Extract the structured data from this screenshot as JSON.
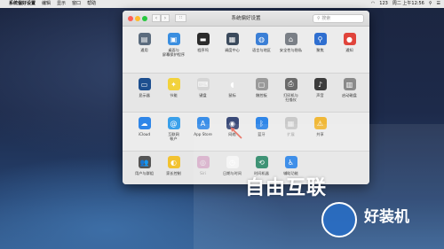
{
  "menubar": {
    "apple": "",
    "app_name": "系统偏好设置",
    "items": [
      "编辑",
      "显示",
      "窗口",
      "帮助"
    ],
    "time": "周二 上午12:56",
    "input": "123"
  },
  "window": {
    "title": "系统偏好设置",
    "search_placeholder": "搜索",
    "grid_label": "∷"
  },
  "panes": {
    "row1": [
      {
        "label": "通用",
        "icon": "general-icon",
        "color": "#5b6b7d",
        "glyph": "▤"
      },
      {
        "label": "桌面与\n屏幕保护程序",
        "icon": "desktop-icon",
        "color": "#3a8ee0",
        "glyph": "▣"
      },
      {
        "label": "程序坞",
        "icon": "dock-icon",
        "color": "#2b2b2b",
        "glyph": "▬"
      },
      {
        "label": "调度中心",
        "icon": "mission-control-icon",
        "color": "#3b4a5c",
        "glyph": "▦"
      },
      {
        "label": "语言与地区",
        "icon": "language-icon",
        "color": "#3b7fd6",
        "glyph": "◍"
      },
      {
        "label": "安全性与隐私",
        "icon": "security-icon",
        "color": "#7a7f86",
        "glyph": "⌂"
      },
      {
        "label": "聚焦",
        "icon": "spotlight-icon",
        "color": "#2f6fd0",
        "glyph": "⚲"
      },
      {
        "label": "通知",
        "icon": "notifications-icon",
        "color": "#e0443b",
        "glyph": "●"
      }
    ],
    "row2": [
      {
        "label": "显示器",
        "icon": "displays-icon",
        "color": "#1d4f8f",
        "glyph": "▭"
      },
      {
        "label": "节能",
        "icon": "energy-icon",
        "color": "#f2d23c",
        "glyph": "✦"
      },
      {
        "label": "键盘",
        "icon": "keyboard-icon",
        "color": "#d5d5d5",
        "glyph": "⌨"
      },
      {
        "label": "鼠标",
        "icon": "mouse-icon",
        "color": "#e6e6e6",
        "glyph": "◖"
      },
      {
        "label": "触控板",
        "icon": "trackpad-icon",
        "color": "#9a9a9a",
        "glyph": "▢"
      },
      {
        "label": "打印机与\n扫描仪",
        "icon": "printer-icon",
        "color": "#6b6b6b",
        "glyph": "⎙"
      },
      {
        "label": "声音",
        "icon": "sound-icon",
        "color": "#3c3c3c",
        "glyph": "♪"
      },
      {
        "label": "启动磁盘",
        "icon": "startup-disk-icon",
        "color": "#8a8a8a",
        "glyph": "▥"
      }
    ],
    "row3": [
      {
        "label": "iCloud",
        "icon": "icloud-icon",
        "color": "#2f86e8",
        "glyph": "☁"
      },
      {
        "label": "互联网\n帐户",
        "icon": "internet-accounts-icon",
        "color": "#3aa0ea",
        "glyph": "@"
      },
      {
        "label": "App Store",
        "icon": "app-store-icon",
        "color": "#3a8ee8",
        "glyph": "A"
      },
      {
        "label": "网络",
        "icon": "network-icon",
        "color": "#3a4a78",
        "glyph": "◉"
      },
      {
        "label": "蓝牙",
        "icon": "bluetooth-icon",
        "color": "#2f86e8",
        "glyph": "ᛒ"
      },
      {
        "label": "扩展",
        "icon": "extensions-icon",
        "color": "#8a8a8a",
        "glyph": "▦"
      },
      {
        "label": "共享",
        "icon": "sharing-icon",
        "color": "#f0b838",
        "glyph": "⚠"
      }
    ],
    "row4": [
      {
        "label": "用户与群组",
        "icon": "users-icon",
        "color": "#555555",
        "glyph": "👥"
      },
      {
        "label": "家长控制",
        "icon": "parental-controls-icon",
        "color": "#f2c230",
        "glyph": "◐"
      },
      {
        "label": "Siri",
        "icon": "siri-icon",
        "color": "#c0509a",
        "glyph": "◎"
      },
      {
        "label": "日期与时间",
        "icon": "date-time-icon",
        "color": "#f5f5f5",
        "glyph": "◷"
      },
      {
        "label": "时间机器",
        "icon": "time-machine-icon",
        "color": "#2f8a6a",
        "glyph": "⟲"
      },
      {
        "label": "辅助功能",
        "icon": "accessibility-icon",
        "color": "#2f86e8",
        "glyph": "♿"
      }
    ]
  },
  "watermark": {
    "top": "自由互联",
    "bottom": "好装机"
  }
}
